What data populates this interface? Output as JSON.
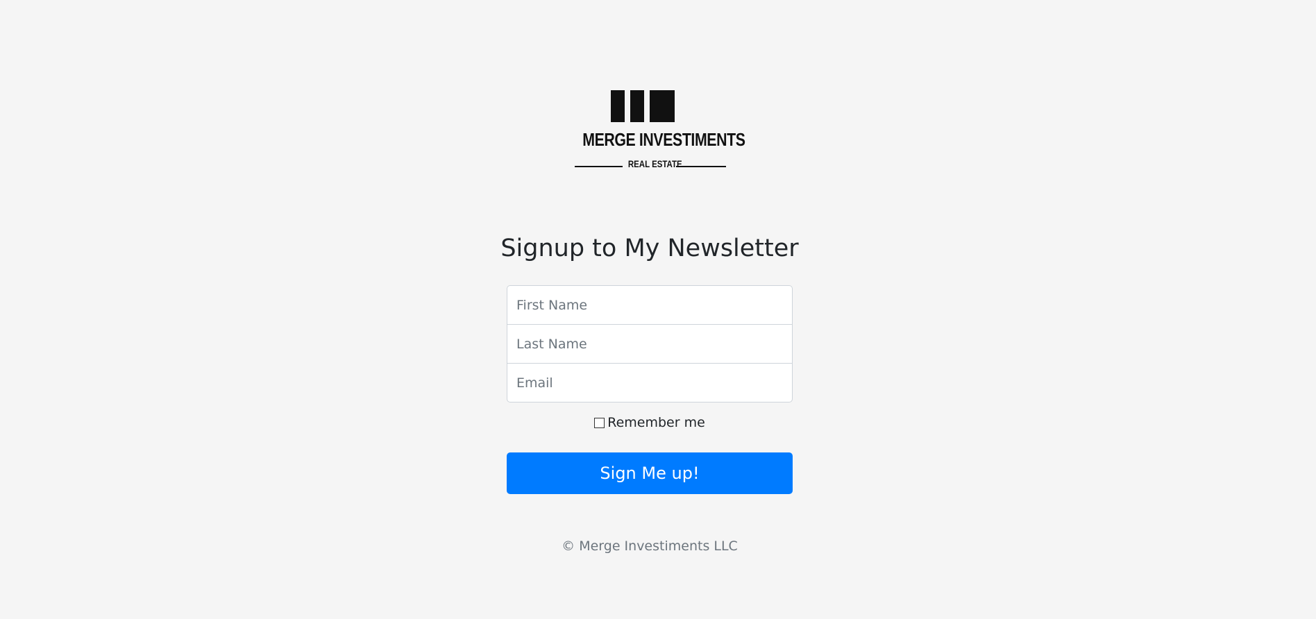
{
  "brand": {
    "name": "MERGE INVESTIMENTS",
    "tagline": "REAL ESTATE"
  },
  "heading": "Signup to My Newsletter",
  "form": {
    "first_name": {
      "placeholder": "First Name",
      "value": ""
    },
    "last_name": {
      "placeholder": "Last Name",
      "value": ""
    },
    "email": {
      "placeholder": "Email",
      "value": ""
    },
    "remember_label": "Remember me",
    "remember_checked": false,
    "submit_label": "Sign Me up!"
  },
  "footer": "© Merge Investiments LLC",
  "colors": {
    "background": "#f5f5f5",
    "primary": "#007bff",
    "muted_text": "#6c757d"
  }
}
